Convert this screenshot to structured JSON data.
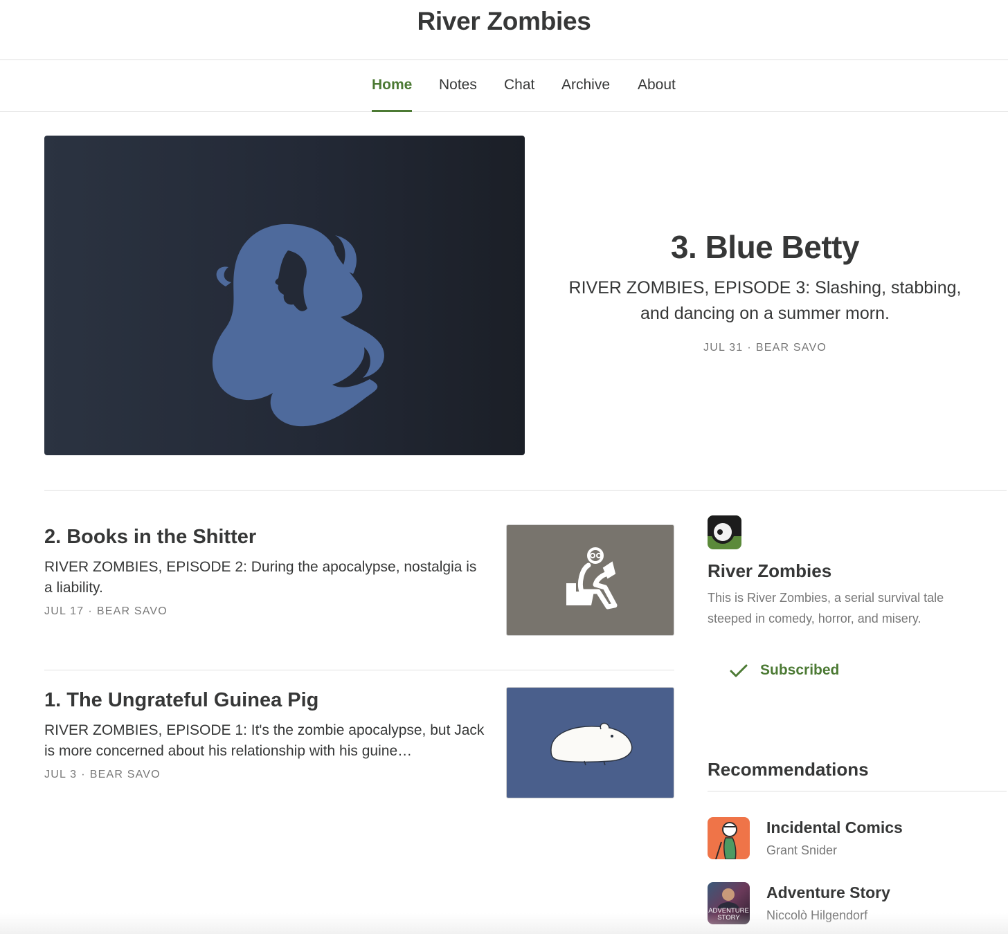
{
  "site": {
    "title": "River Zombies"
  },
  "nav": {
    "home": "Home",
    "notes": "Notes",
    "chat": "Chat",
    "archive": "Archive",
    "about": "About"
  },
  "hero": {
    "title": "3. Blue Betty",
    "subtitle": "RIVER ZOMBIES, EPISODE 3: Slashing, stabbing, and dancing on a summer morn.",
    "date": "JUL 31",
    "author": "BEAR SAVO",
    "image_icon": "woman-silhouette-icon"
  },
  "posts": [
    {
      "title": "2. Books in the Shitter",
      "subtitle": "RIVER ZOMBIES, EPISODE 2: During the apocalypse, nostalgia is a liability.",
      "date": "JUL 17",
      "author": "BEAR SAVO",
      "image_icon": "reading-on-toilet-icon"
    },
    {
      "title": "1. The Ungrateful Guinea Pig",
      "subtitle": "RIVER ZOMBIES, EPISODE 1: It's the zombie apocalypse, but Jack is more concerned about his relationship with his guine…",
      "date": "JUL 3",
      "author": "BEAR SAVO",
      "image_icon": "guinea-pig-icon"
    }
  ],
  "sidebar": {
    "name": "River Zombies",
    "description": "This is River Zombies, a serial survival tale steeped in comedy, horror, and misery.",
    "subscribed_label": "Subscribed",
    "recommendations_heading": "Recommendations",
    "recommendations": [
      {
        "name": "Incidental Comics",
        "author": "Grant Snider"
      },
      {
        "name": "Adventure Story",
        "author": "Niccolò Hilgendorf",
        "logo_text_1": "ADVENTURE",
        "logo_text_2": "STORY"
      }
    ]
  },
  "colors": {
    "accent": "#4c7a34",
    "text": "#363737",
    "muted": "#777777",
    "hero_bg": "#232936",
    "figure_blue": "#4e6a9c",
    "thumb_gray": "#78746d",
    "thumb_blue": "#4a5f8c"
  }
}
